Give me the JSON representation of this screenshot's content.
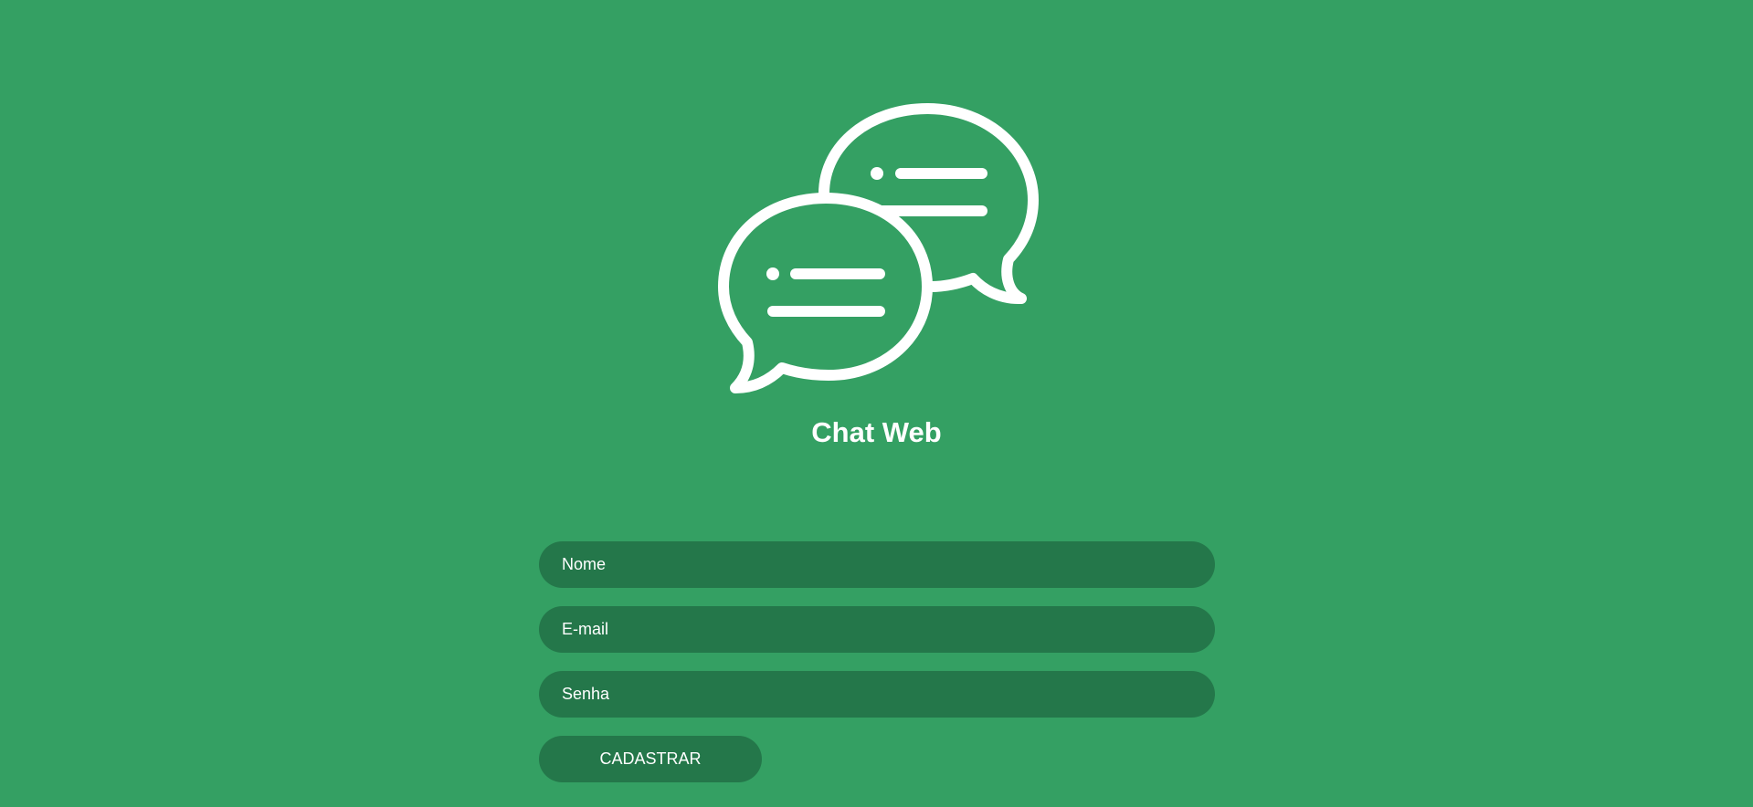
{
  "app": {
    "title": "Chat Web",
    "logo_icon": "chat-bubbles-icon"
  },
  "form": {
    "name_placeholder": "Nome",
    "email_placeholder": "E-mail",
    "password_placeholder": "Senha",
    "submit_label": "CADASTRAR"
  },
  "colors": {
    "background": "#34a063",
    "field_background": "#24774a",
    "foreground": "#ffffff"
  }
}
